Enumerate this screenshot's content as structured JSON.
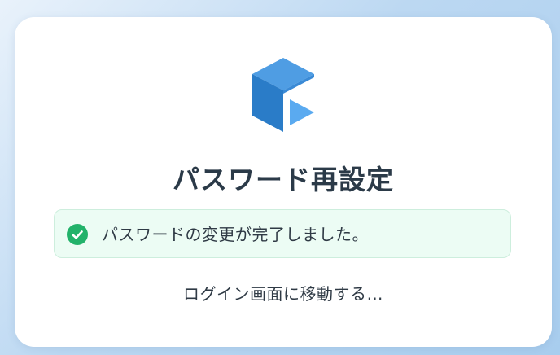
{
  "app": {
    "logo_icon": "brand-logo-icon"
  },
  "page": {
    "title": "パスワード再設定"
  },
  "alert": {
    "icon": "check-circle-icon",
    "message": "パスワードの変更が完了しました。",
    "color": "#22b26a",
    "background": "#ecfcf4"
  },
  "status": {
    "redirect_text": "ログイン画面に移動する…"
  }
}
